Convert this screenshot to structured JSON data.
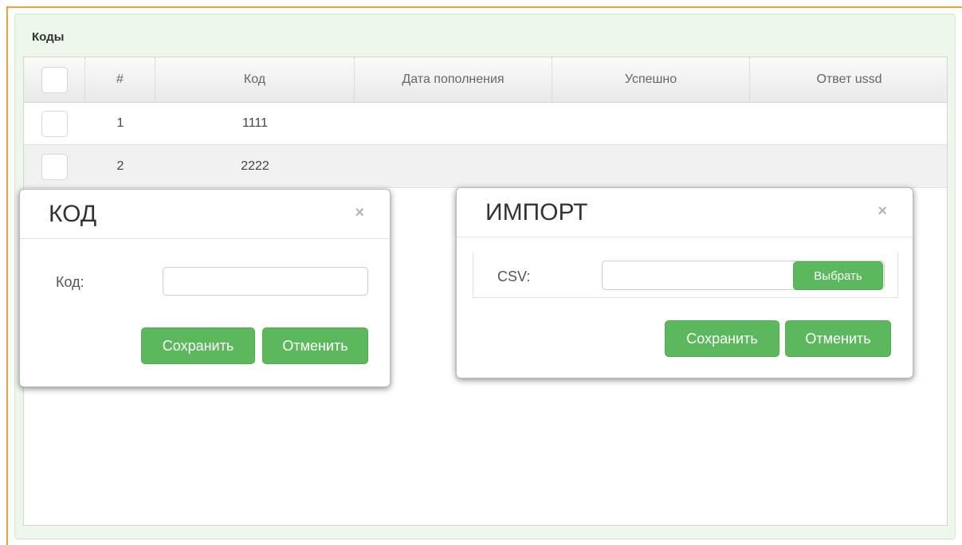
{
  "panel": {
    "title": "Коды"
  },
  "table": {
    "columns": [
      "",
      "#",
      "Код",
      "Дата пополнения",
      "Успешно",
      "Ответ ussd"
    ],
    "rows": [
      {
        "num": "1",
        "code": "1111",
        "date": "",
        "success": "",
        "ussd": ""
      },
      {
        "num": "2",
        "code": "2222",
        "date": "",
        "success": "",
        "ussd": ""
      }
    ]
  },
  "code_dialog": {
    "title": "КОД",
    "close": "×",
    "field_label": "Код:",
    "field_value": "",
    "save_label": "Сохранить",
    "cancel_label": "Отменить"
  },
  "import_dialog": {
    "title": "ИМПОРТ",
    "close": "×",
    "field_label": "CSV:",
    "field_value": "",
    "browse_label": "Выбрать",
    "save_label": "Сохранить",
    "cancel_label": "Отменить"
  },
  "colors": {
    "accent": "#5cb85c",
    "frame": "#f0a23a",
    "panel_bg": "#eef7ec"
  }
}
